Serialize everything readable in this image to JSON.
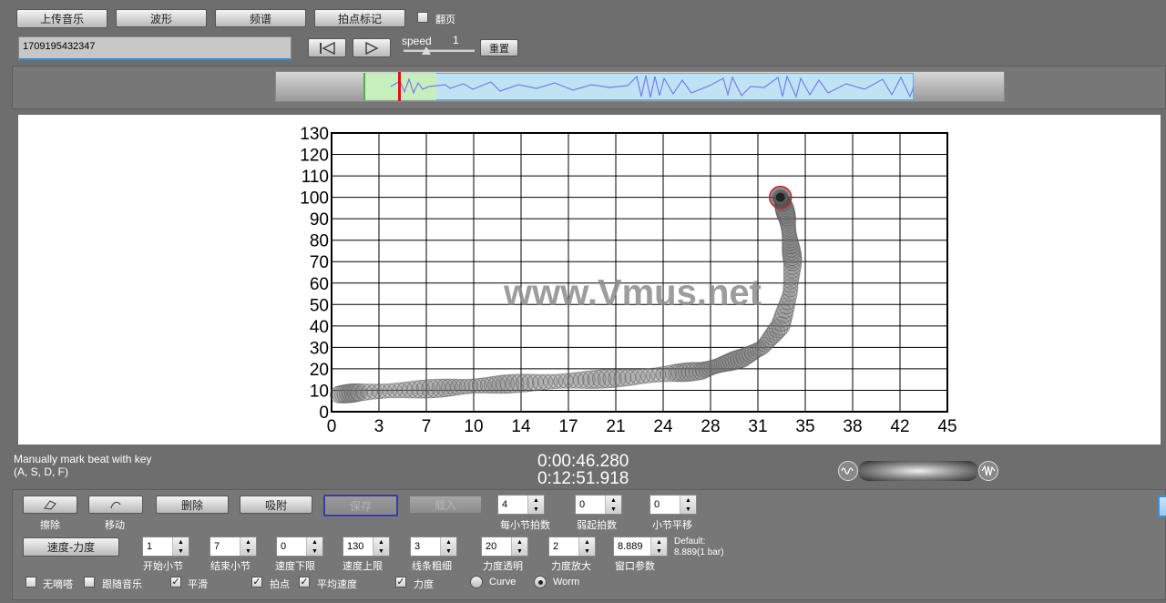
{
  "toolbar": {
    "upload": "上传音乐",
    "waveform": "波形",
    "spectrum": "频谱",
    "tap_marks": "拍点标记",
    "page_flip": "翻页"
  },
  "file": {
    "id": "1709195432347"
  },
  "playback": {
    "speed_label": "speed",
    "speed_value": "1",
    "reset": "重置"
  },
  "chart_data": {
    "type": "scatter",
    "x_ticks": [
      "0",
      "3",
      "7",
      "10",
      "14",
      "17",
      "21",
      "24",
      "28",
      "31",
      "35",
      "38",
      "42",
      "45"
    ],
    "y_ticks": [
      "0",
      "10",
      "20",
      "30",
      "40",
      "50",
      "60",
      "70",
      "80",
      "90",
      "100",
      "110",
      "120",
      "130"
    ],
    "xlim": [
      0,
      45
    ],
    "ylim": [
      0,
      130
    ],
    "grid": true,
    "watermark": "www.Vmus.net",
    "series": [
      {
        "values": [
          [
            0.5,
            8
          ],
          [
            2,
            9
          ],
          [
            5,
            10
          ],
          [
            8,
            11
          ],
          [
            10.5,
            12
          ],
          [
            13,
            13
          ],
          [
            16,
            14
          ],
          [
            19,
            15
          ],
          [
            22,
            16
          ],
          [
            25,
            18
          ],
          [
            27,
            19
          ],
          [
            28.5,
            22
          ],
          [
            30,
            25
          ],
          [
            31.5,
            30
          ],
          [
            32.8,
            40
          ],
          [
            33.5,
            55
          ],
          [
            33.7,
            70
          ],
          [
            33.5,
            80
          ],
          [
            33.3,
            90
          ],
          [
            33,
            97
          ],
          [
            32.8,
            100
          ]
        ]
      }
    ]
  },
  "status": {
    "hint_line1": "Manually mark beat with key",
    "hint_line2": "(A, S, D, F)",
    "time_current": "0:00:46.280",
    "time_total": "0:12:51.918"
  },
  "controls": {
    "erase": "擦除",
    "move": "移动",
    "delete": "删除",
    "snap": "吸附",
    "save": "保存",
    "load": "载入",
    "beats_per_bar_label": "每小节拍数",
    "beats_per_bar": "4",
    "upbeat_label": "弱起拍数",
    "upbeat": "0",
    "bar_offset_label": "小节平移",
    "bar_offset": "0",
    "tempo_dynamics": "速度-力度",
    "start_bar_label": "开始小节",
    "start_bar": "1",
    "end_bar_label": "结束小节",
    "end_bar": "7",
    "tempo_min_label": "速度下限",
    "tempo_min": "0",
    "tempo_max_label": "速度上限",
    "tempo_max": "130",
    "line_width_label": "线条粗细",
    "line_width": "3",
    "dyn_transparency_label": "力度透明",
    "dyn_transparency": "20",
    "dyn_scale_label": "力度放大",
    "dyn_scale": "2",
    "window_param_label": "窗口参数",
    "window_param": "8.889",
    "default_line1": "Default:",
    "default_line2": "8.889(1 bar)",
    "no_click": "无嘀嗒",
    "follow_music": "跟随音乐",
    "smooth": "平滑",
    "beat": "拍点",
    "avg_tempo": "平均速度",
    "dynamics": "力度",
    "curve": "Curve",
    "worm": "Worm"
  }
}
